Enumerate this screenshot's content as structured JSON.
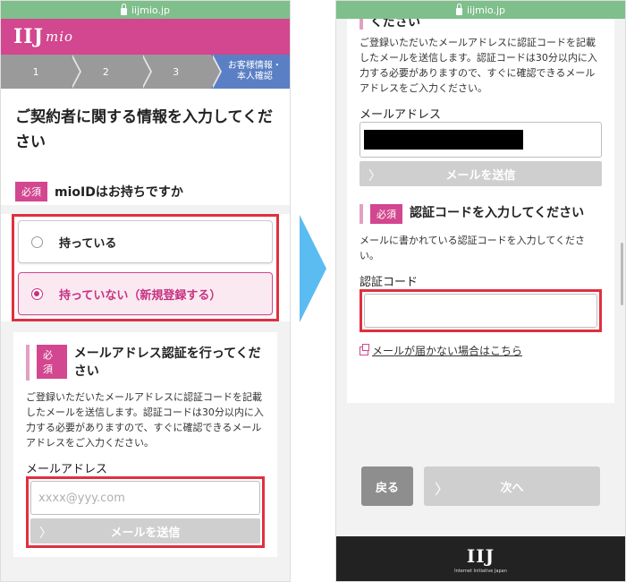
{
  "browser": {
    "url": "iijmio.jp"
  },
  "brand": {
    "logo_main": "IIJ",
    "logo_sub": "mio"
  },
  "steps": [
    "1",
    "2",
    "3"
  ],
  "current_step": {
    "line1": "お客様情報・",
    "line2": "本人確認"
  },
  "page_title": "ご契約者に関する情報を入力してください",
  "mioid": {
    "required_badge": "必須",
    "question": "mioIDはお持ちですか",
    "options": [
      "持っている",
      "持っていない（新規登録する）"
    ]
  },
  "email_verify": {
    "required_badge": "必須",
    "title": "メールアドレス認証を行ってください",
    "description": "ご登録いただいたメールアドレスに認証コードを記載したメールを送信します。認証コードは30分以内に入力する必要がありますので、すぐに確認できるメールアドレスをご入力ください。",
    "field_label": "メールアドレス",
    "placeholder": "xxxx@yyy.com",
    "send_button": "メールを送信"
  },
  "right_top": {
    "title_fragment": "ください",
    "description": "ご登録いただいたメールアドレスに認証コードを記載したメールを送信します。認証コードは30分以内に入力する必要がありますので、すぐに確認できるメールアドレスをご入力ください。",
    "field_label": "メールアドレス",
    "send_button": "メールを送信"
  },
  "auth_code": {
    "required_badge": "必須",
    "title": "認証コードを入力してください",
    "description": "メールに書かれている認証コードを入力してください。",
    "field_label": "認証コード",
    "help_link": "メールが届かない場合はこちら"
  },
  "nav": {
    "back": "戻る",
    "next": "次へ"
  },
  "footer": {
    "logo": "IIJ",
    "tagline": "Internet Initiative Japan"
  }
}
